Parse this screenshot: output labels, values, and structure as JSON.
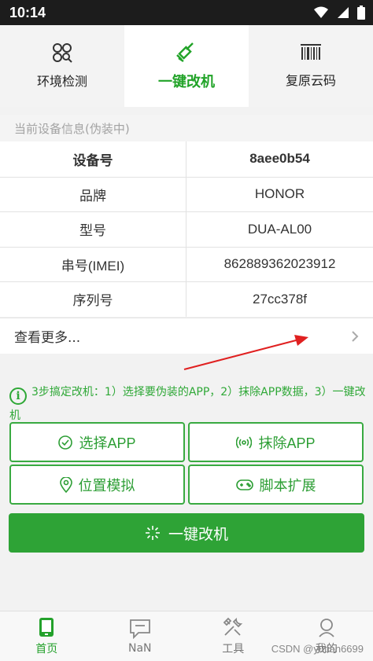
{
  "status_bar": {
    "time": "10:14"
  },
  "top_tabs": [
    {
      "label": "环境检测",
      "icon": "detect-icon"
    },
    {
      "label": "一键改机",
      "icon": "broom-icon",
      "active": true
    },
    {
      "label": "复原云码",
      "icon": "barcode-icon"
    }
  ],
  "device_info": {
    "header": "当前设备信息(伪装中)",
    "rows": [
      {
        "key": "设备号",
        "value": "8aee0b54"
      },
      {
        "key": "品牌",
        "value": "HONOR"
      },
      {
        "key": "型号",
        "value": "DUA-AL00"
      },
      {
        "key": "串号(IMEI)",
        "value": "862889362023912"
      },
      {
        "key": "序列号",
        "value": "27cc378f"
      }
    ],
    "more_label": "查看更多..."
  },
  "hint": {
    "icon_text": "i",
    "text": "3步搞定改机：1）选择要伪装的APP，2）抹除APP数据，3）一键改机"
  },
  "actions": {
    "select_app": "选择APP",
    "erase_app": "抹除APP",
    "location": "位置模拟",
    "script": "脚本扩展",
    "main": "一键改机"
  },
  "bottom_nav": [
    {
      "label": "首页",
      "icon": "phone-icon",
      "active": true
    },
    {
      "label": "NaN",
      "icon": "chat-icon"
    },
    {
      "label": "工具",
      "icon": "tools-icon"
    },
    {
      "label": "我的",
      "icon": "person-icon"
    }
  ],
  "watermark": "CSDN @yutian6699",
  "colors": {
    "accent": "#2ea336",
    "annotation_arrow": "#e02020"
  }
}
